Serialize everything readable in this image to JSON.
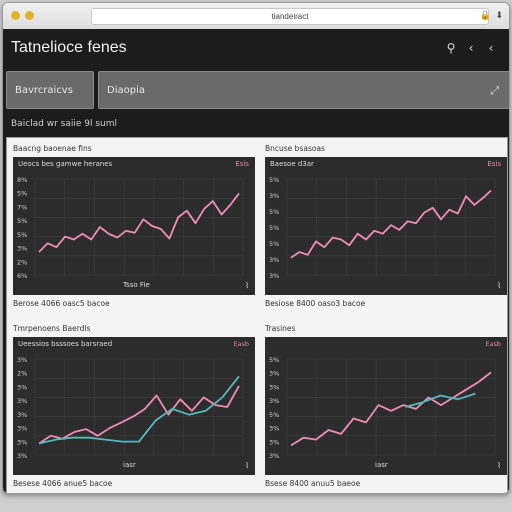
{
  "window": {
    "url": "tiandeiract",
    "titlebar_icons": [
      "lock-icon",
      "download-icon"
    ]
  },
  "app": {
    "title": "Tatnelioce fenes"
  },
  "header_icons": [
    "search-icon",
    "back-icon",
    "back-icon"
  ],
  "filters": {
    "f1": "Bavrcraicvs",
    "f2": "Diaopia"
  },
  "subtitle": "Baiclad wr saiie 9l suml",
  "colors": {
    "pink": "#f08cb6",
    "teal": "#57b9bf",
    "plot_bg": "#2c2c2c",
    "grid": "#3f3f3f"
  },
  "cards": [
    {
      "title": "Baacng baoenae fins",
      "plot_header": "Ueocs bes gamwe heranes",
      "plot_corner": "Esis",
      "xlabel": "Tsso Fie",
      "footer": "Berose 4066 oasc5 bacoe",
      "chart_data": {
        "type": "line",
        "y_ticks": [
          "8%",
          "5%",
          "7%",
          "5%",
          "5%",
          "3%",
          "2%",
          "6%"
        ],
        "series": [
          {
            "color": "#f08cb6",
            "values": [
              24,
              33,
              29,
              40,
              37,
              43,
              37,
              50,
              43,
              39,
              46,
              44,
              58,
              51,
              48,
              38,
              60,
              67,
              54,
              69,
              77,
              63,
              73,
              85
            ]
          }
        ]
      }
    },
    {
      "title": "Bncuse bsasoas",
      "plot_header": "Baesoe d3ar",
      "plot_corner": "Esis",
      "xlabel": "",
      "footer": "Besiose 8400 oaso3 bacoe",
      "chart_data": {
        "type": "line",
        "y_ticks": [
          "5%",
          "3%",
          "5%",
          "5%",
          "5%",
          "3%",
          "3%"
        ],
        "series": [
          {
            "color": "#f08cb6",
            "values": [
              18,
              24,
              21,
              35,
              29,
              39,
              37,
              31,
              43,
              37,
              46,
              43,
              52,
              47,
              56,
              54,
              65,
              70,
              58,
              68,
              64,
              82,
              73,
              80,
              88
            ]
          }
        ]
      }
    },
    {
      "title": "Tmrpenoens Baerdls",
      "plot_header": "Ueessios bsssoes barsraed",
      "plot_corner": "Easb",
      "xlabel": "iasr",
      "footer": "Besese 4066 anue5 bacoe",
      "chart_data": {
        "type": "line",
        "y_ticks": [
          "3%",
          "2%",
          "3%",
          "3%",
          "3%",
          "3%",
          "3%",
          "3%"
        ],
        "series": [
          {
            "color": "#f08cb6",
            "values": [
              12,
              20,
              17,
              24,
              27,
              20,
              28,
              34,
              40,
              48,
              62,
              42,
              58,
              46,
              60,
              52,
              50,
              72
            ]
          },
          {
            "color": "#57b9bf",
            "values": [
              12,
              16,
              18,
              18,
              16,
              14,
              14,
              36,
              48,
              42,
              46,
              60,
              82
            ]
          }
        ]
      }
    },
    {
      "title": "Trasines",
      "plot_header": "",
      "plot_corner": "Easb",
      "xlabel": "iasr",
      "footer": "Bsese 8400 anuu5 baeoe",
      "chart_data": {
        "type": "line",
        "y_ticks": [
          "5%",
          "3%",
          "3%",
          "3%",
          "5%",
          "3%",
          "3%",
          "3%"
        ],
        "series": [
          {
            "color": "#f08cb6",
            "values": [
              10,
              18,
              16,
              26,
              22,
              38,
              34,
              52,
              46,
              52,
              48,
              60,
              52,
              60,
              68,
              76,
              86
            ]
          },
          {
            "color": "#57b9bf",
            "values": [
              50,
              55,
              62,
              58,
              64
            ]
          }
        ]
      }
    }
  ]
}
